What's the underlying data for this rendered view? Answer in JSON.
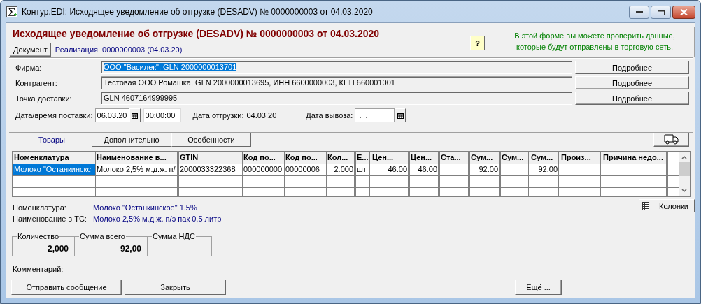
{
  "window": {
    "title": "Контур.EDI: Исходящее уведомление об отгрузке (DESADV) № 0000000003 от 04.03.2020"
  },
  "header": {
    "title": "Исходящее уведомление об отгрузке (DESADV) № 0000000003 от 04.03.2020",
    "document_button": "Документ",
    "document_type": "Реализация",
    "document_number": "0000000003 (04.03.20)",
    "help_button": "?",
    "note": "В этой форме вы можете проверить данные, которые будут отправлены в торговую сеть."
  },
  "fields": [
    {
      "label": "Фирма:",
      "value": "ООО \"Василек\", GLN 2000000013701",
      "text_selected": true,
      "button": "Подробнее"
    },
    {
      "label": "Контрагент:",
      "value": "Тестовая ООО Ромашка, GLN 2000000013695, ИНН 6600000003, КПП 660001001",
      "text_selected": false,
      "button": "Подробнее"
    },
    {
      "label": "Точка доставки:",
      "value": "GLN 4607164999995",
      "text_selected": false,
      "button": "Подробнее"
    }
  ],
  "dates": {
    "delivery_label": "Дата/время поставки:",
    "delivery_date": "06.03.20",
    "delivery_time": "00:00:00",
    "shipment_label": "Дата отгрузки:",
    "shipment_date": "04.03.20",
    "pickup_label": "Дата вывоза:",
    "pickup_date": " .  ."
  },
  "tabs": [
    {
      "label": "Товары",
      "selected": true
    },
    {
      "label": "Дополнительно",
      "selected": false
    },
    {
      "label": "Особенности",
      "selected": false
    }
  ],
  "table": {
    "columns": [
      {
        "label": "Номенклатура",
        "kind": "text"
      },
      {
        "label": "Наименование в...",
        "kind": "text"
      },
      {
        "label": "GTIN",
        "kind": "text"
      },
      {
        "label": "Код по...",
        "kind": "text"
      },
      {
        "label": "Код по...",
        "kind": "text"
      },
      {
        "label": "Кол...",
        "kind": "number"
      },
      {
        "label": "Е...",
        "kind": "text"
      },
      {
        "label": "Цен...",
        "kind": "number"
      },
      {
        "label": "Цен...",
        "kind": "number"
      },
      {
        "label": "Ста...",
        "kind": "number"
      },
      {
        "label": "Сум...",
        "kind": "number"
      },
      {
        "label": "Сум...",
        "kind": "number"
      },
      {
        "label": "Сум...",
        "kind": "number"
      },
      {
        "label": "Произ...",
        "kind": "text"
      },
      {
        "label": "Причина недо...",
        "kind": "text"
      }
    ],
    "rows": [
      {
        "selected": true,
        "cells": [
          "Молоко \"Останкинскс",
          "Молоко 2,5% м.д.ж. п/",
          "2000033322368",
          "000000000",
          "00000006",
          "2.000",
          "шт",
          "46.00",
          "46.00",
          "",
          "92.00",
          "",
          "92.00",
          "",
          ""
        ]
      }
    ]
  },
  "columns_button": "Колонки",
  "details": [
    {
      "label": "Номенклатура:",
      "value": "Молоко \"Останкинское\" 1.5%"
    },
    {
      "label": "Наименование в ТС:",
      "value": "Молоко 2,5% м.д.ж. п/э пак 0,5 литр"
    }
  ],
  "totals": [
    {
      "label": "Количество",
      "value": "2,000"
    },
    {
      "label": "Сумма всего",
      "value": "92,00"
    },
    {
      "label": "Сумма НДС"
    }
  ],
  "comment_label": "Комментарий:",
  "buttons": [
    {
      "label": "Отправить сообщение",
      "kind": "send"
    },
    {
      "label": "Закрыть",
      "kind": "close"
    },
    {
      "label": "Ещё ...",
      "kind": "more"
    }
  ]
}
